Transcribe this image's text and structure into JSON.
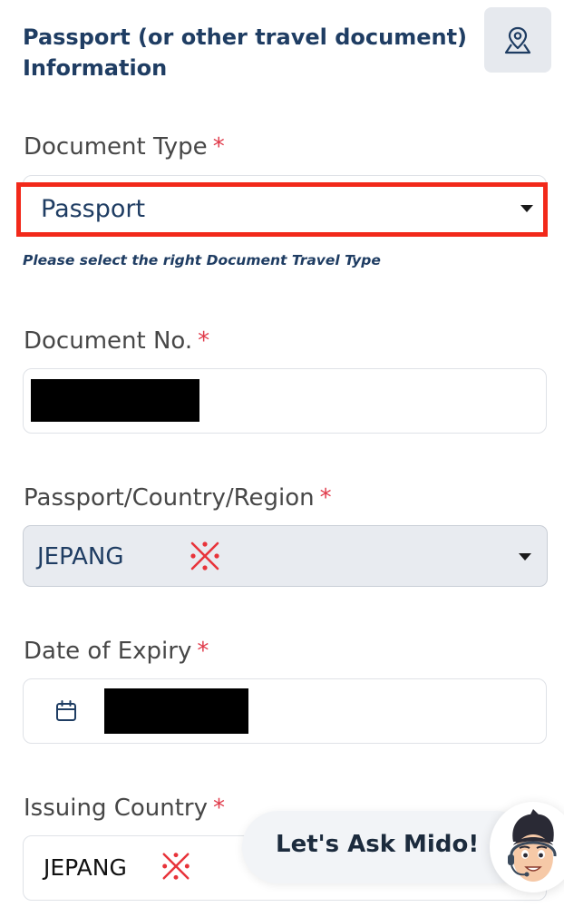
{
  "section": {
    "title_line1": "Passport (or other travel document)",
    "title_line2": "Information"
  },
  "required_mark": "*",
  "document_type": {
    "label": "Document Type",
    "selected": "Passport",
    "hint": "Please select the right Document Travel Type"
  },
  "document_no": {
    "label": "Document No."
  },
  "passport_country": {
    "label": "Passport/Country/Region",
    "selected": "JEPANG"
  },
  "date_of_expiry": {
    "label": "Date of Expiry"
  },
  "issuing_country": {
    "label": "Issuing Country",
    "value": "JEPANG"
  },
  "chat_widget": {
    "label": "Let's Ask Mido!"
  },
  "icons": {
    "map": "map-pin-icon",
    "calendar": "calendar-icon",
    "dropdown": "caret-down-icon",
    "annotation": "red-x-mark-icon"
  },
  "colors": {
    "title": "#1f3d63",
    "required": "#e03a4a",
    "highlight": "#f2291a",
    "annotation": "#e8333a"
  }
}
